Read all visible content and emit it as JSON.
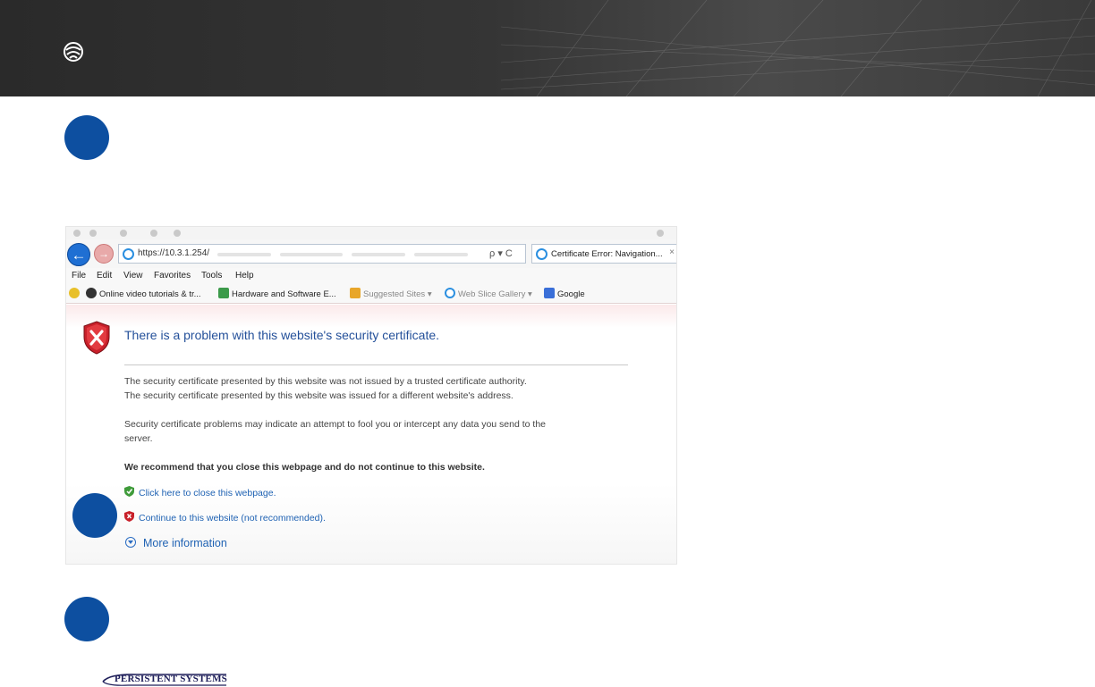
{
  "browser": {
    "url": "https://10.3.1.254/",
    "tab_title": "Certificate Error: Navigation...",
    "tab_close": "×",
    "back_icon": "back-arrow-icon",
    "search_controls": "ρ ▾ C",
    "menu": [
      "File",
      "Edit",
      "View",
      "Favorites",
      "Tools",
      "Help"
    ],
    "favorites": [
      "Online video tutorials & tr...",
      "Hardware and Software E...",
      "Suggested Sites ▾",
      "Web Slice Gallery ▾",
      "Google"
    ]
  },
  "cert_error": {
    "title": "There is a problem with this website's security certificate.",
    "line1": "The security certificate presented by this website was not issued by a trusted certificate authority.",
    "line2": "The security certificate presented by this website was issued for a different website's address.",
    "line3a": "Security certificate problems may indicate an attempt to fool you or intercept any data you send to the",
    "line3b": "server.",
    "recommend": "We recommend that you close this webpage and do not continue to this website.",
    "close_link": "Click here to close this webpage.",
    "continue_link": "Continue to this website (not recommended).",
    "more_info": "More information"
  },
  "footer": {
    "brand": "PERSISTENT SYSTEMS"
  },
  "colors": {
    "step_circle": "#0d4fa0",
    "banner": "#353535",
    "link": "#1f62b3"
  }
}
